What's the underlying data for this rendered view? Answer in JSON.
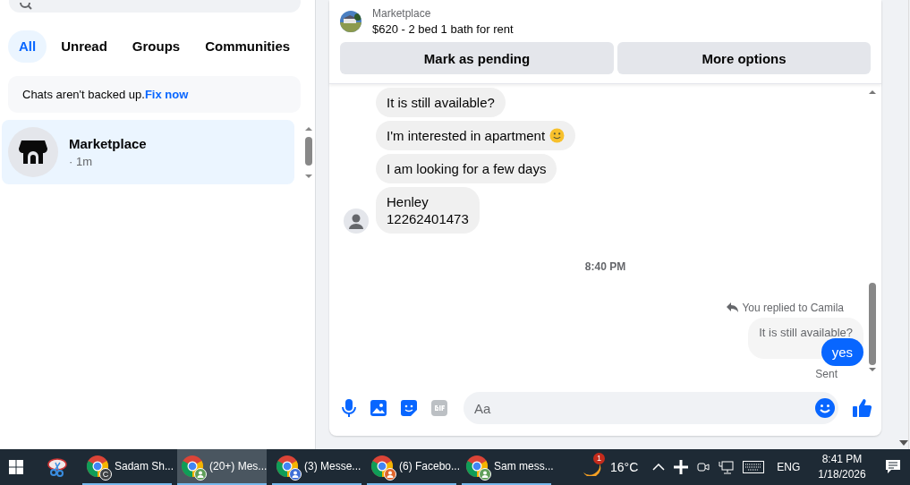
{
  "sidebar": {
    "tabs": [
      {
        "label": "All",
        "selected": true
      },
      {
        "label": "Unread",
        "selected": false
      },
      {
        "label": "Groups",
        "selected": false
      },
      {
        "label": "Communities",
        "selected": false
      }
    ],
    "backup_notice": {
      "text": "Chats aren't backed up.",
      "link": "Fix now"
    },
    "chats": [
      {
        "name": "Marketplace",
        "time": "· 1m",
        "selected": true
      }
    ]
  },
  "conversation": {
    "listing": {
      "source": "Marketplace",
      "title": "$620 - 2 bed 1 bath for rent"
    },
    "buttons": [
      "Mark as pending",
      "More options"
    ],
    "messages": [
      {
        "kind": "incoming",
        "text": "It is still available?"
      },
      {
        "kind": "incoming",
        "text": "I'm interested in apartment",
        "smiley": true
      },
      {
        "kind": "incoming",
        "text": "I am looking for a few days"
      },
      {
        "kind": "incoming",
        "text": "Henley\n12262401473",
        "avatar": true
      },
      {
        "kind": "timestamp",
        "text": "8:40 PM"
      },
      {
        "kind": "reply_label",
        "text": "You replied to Camila"
      },
      {
        "kind": "quoted",
        "text": "It is still available?"
      },
      {
        "kind": "outgoing",
        "text": "yes"
      },
      {
        "kind": "status",
        "text": "Sent"
      }
    ],
    "composer": {
      "placeholder": "Aa"
    }
  },
  "taskbar": {
    "apps": [
      {
        "label": "Sadam Sh...",
        "badge": "C",
        "color": "#3c4043",
        "selected": false
      },
      {
        "label": "(20+) Mes...",
        "color": "#5f9e5a",
        "selected": true
      },
      {
        "label": "(3) Messe...",
        "color": "#3f6fd6",
        "selected": false
      },
      {
        "label": "(6) Facebo...",
        "color": "#e0662c",
        "selected": false
      },
      {
        "label": "Sam mess...",
        "color": "#5f9e5a",
        "selected": false
      }
    ],
    "weather": {
      "badge": "1",
      "temperature": "16°C"
    },
    "language": "ENG",
    "time": "8:41 PM",
    "date": "1/18/2026"
  }
}
